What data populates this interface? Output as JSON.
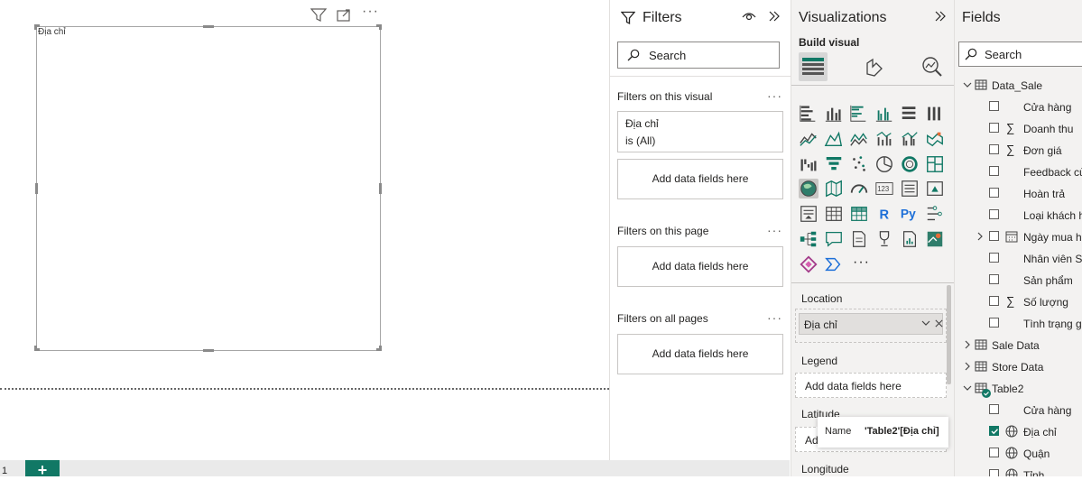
{
  "visual": {
    "title": "Địa chỉ"
  },
  "page_nav": {
    "add_label": "+",
    "page_number": "1"
  },
  "filters": {
    "title": "Filters",
    "search_placeholder": "Search",
    "on_visual_label": "Filters on this visual",
    "filter_card": {
      "field": "Địa chỉ",
      "condition": "is (All)"
    },
    "add_fields_label": "Add data fields here",
    "on_page_label": "Filters on this page",
    "on_all_pages_label": "Filters on all pages",
    "more_label": "···"
  },
  "visualizations": {
    "title": "Visualizations",
    "build_visual_label": "Build visual",
    "more_label": "···",
    "wells": {
      "location_label": "Location",
      "location_value": "Địa chỉ",
      "legend_label": "Legend",
      "legend_add": "Add data fields here",
      "latitude_label": "Latitude",
      "latitude_add": "Ad",
      "longitude_label": "Longitude"
    },
    "icon_r": "R",
    "icon_py": "Py",
    "icon_123": "123"
  },
  "tooltip": {
    "name_key": "Name",
    "name_value": "'Table2'[Địa chỉ]"
  },
  "fields": {
    "title": "Fields",
    "search_placeholder": "Search",
    "tables": [
      {
        "name": "Data_Sale",
        "items": [
          "Cửa hàng",
          "Doanh thu",
          "Đơn giá",
          "Feedback củ",
          "Hoàn trả",
          "Loại khách h",
          "Ngày mua hà",
          "Nhân viên Sa",
          "Sản phẩm",
          "Số lượng",
          "Tình trạng gi"
        ]
      },
      {
        "name": "Sale Data"
      },
      {
        "name": "Store Data"
      },
      {
        "name": "Table2",
        "items": [
          "Cửa hàng",
          "Địa chỉ",
          "Quận",
          "Tỉnh"
        ]
      }
    ]
  },
  "colors": {
    "accent": "#117865",
    "pane_bg": "#f3f2f1",
    "border": "#c8c6c4"
  }
}
